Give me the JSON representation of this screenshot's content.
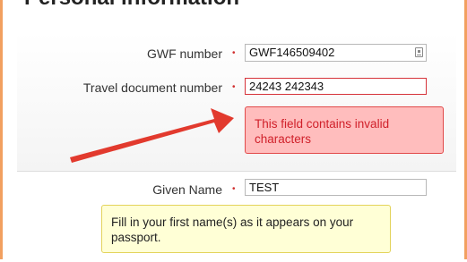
{
  "section": {
    "title": "Personal information"
  },
  "fields": {
    "gwf_number": {
      "label": "GWF number",
      "value": "GWF146509402"
    },
    "travel_document": {
      "label": "Travel document number",
      "value": "24243 242343"
    },
    "given_name": {
      "label": "Given Name",
      "value": "TEST"
    }
  },
  "required_marker": "•",
  "error": {
    "message": "This field contains invalid characters"
  },
  "hint": {
    "message": "Fill in your first name(s) as it appears on your passport."
  },
  "colors": {
    "error_bg": "#ffbdbd",
    "error_border": "#e14a4a",
    "error_text": "#d0202a",
    "hint_bg": "#ffffd6",
    "hint_border": "#e3d35a",
    "arrow": "#e23a2e",
    "frame_border": "#f2a060"
  },
  "icons": {
    "gwf_field_icon": "id-card-icon",
    "annotation": "arrow-annotation"
  }
}
